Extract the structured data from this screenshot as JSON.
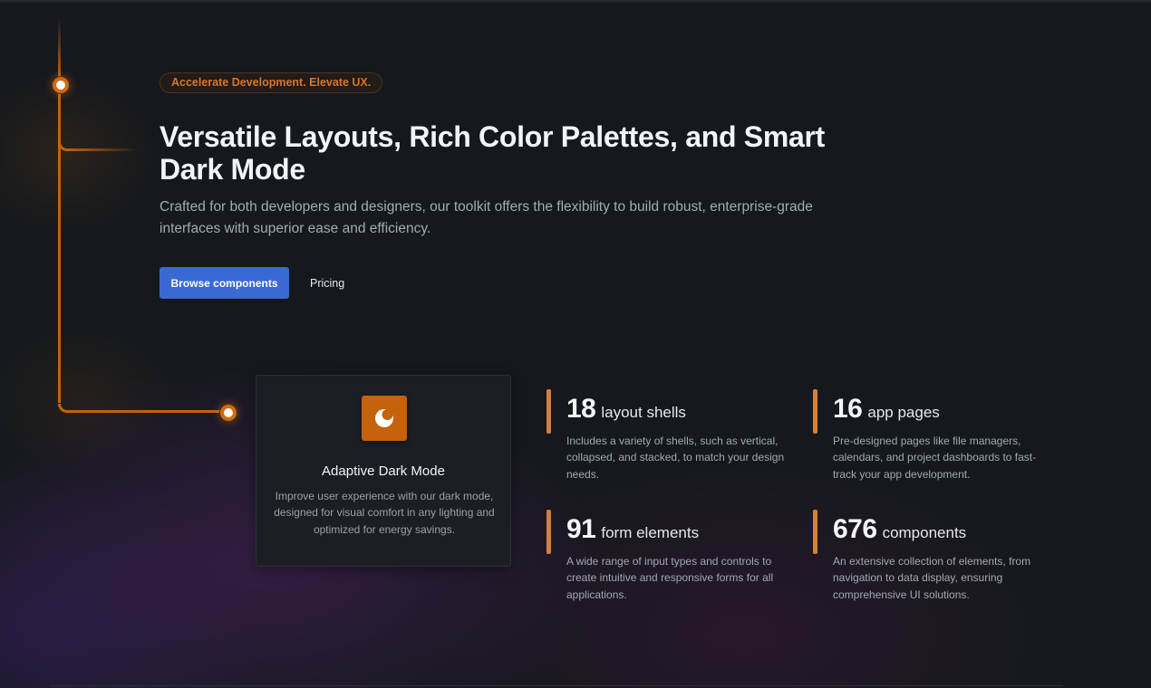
{
  "hero": {
    "badge": "Accelerate Development. Elevate UX.",
    "title": "Versatile Layouts, Rich Color Palettes, and Smart Dark Mode",
    "subtitle": "Crafted for both developers and designers, our toolkit offers the flexibility to build robust, enterprise-grade interfaces with superior ease and efficiency.",
    "primary_button": "Browse components",
    "secondary_button": "Pricing"
  },
  "feature": {
    "icon": "dark-mode-icon",
    "title": "Adaptive Dark Mode",
    "description": "Improve user experience with our dark mode, designed for visual comfort in any lighting and optimized for energy savings."
  },
  "stats": [
    {
      "number": "18",
      "label": "layout shells",
      "description": "Includes a variety of shells, such as vertical, collapsed, and stacked, to match your design needs."
    },
    {
      "number": "16",
      "label": "app pages",
      "description": "Pre-designed pages like file managers, calendars, and project dashboards to fast-track your app development."
    },
    {
      "number": "91",
      "label": "form elements",
      "description": "A wide range of input types and controls to create intuitive and responsive forms for all applications."
    },
    {
      "number": "676",
      "label": "components",
      "description": "An extensive collection of elements, from navigation to data display, ensuring comprehensive UI solutions."
    }
  ],
  "colors": {
    "background": "#15181d",
    "accent_orange": "#c6610c",
    "primary_blue": "#3a69d6",
    "stat_bar": "#d08040"
  }
}
